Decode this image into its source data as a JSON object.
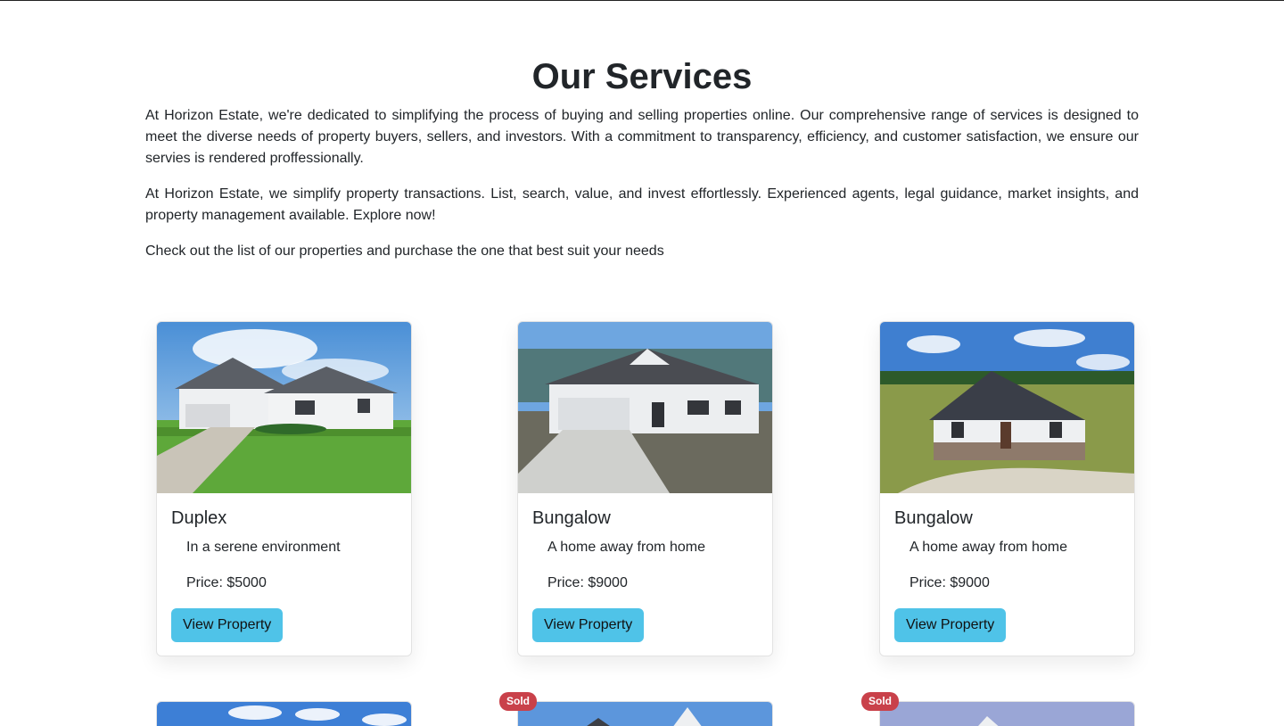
{
  "page": {
    "heading": "Our Services",
    "paragraphs": [
      "At Horizon Estate, we're dedicated to simplifying the process of buying and selling properties online. Our comprehensive range of services is designed to meet the diverse needs of property buyers, sellers, and investors. With a commitment to transparency, efficiency, and customer satisfaction, we ensure our servies is rendered proffessionally.",
      "At Horizon Estate, we simplify property transactions. List, search, value, and invest effortlessly. Experienced agents, legal guidance, market insights, and property management available. Explore now!",
      "Check out the list of our properties and purchase the one that best suit your needs"
    ]
  },
  "properties": [
    {
      "title": "Duplex",
      "description": "In a serene environment",
      "price": "Price: $5000",
      "button": "View Property"
    },
    {
      "title": "Bungalow",
      "description": "A home away from home",
      "price": "Price: $9000",
      "button": "View Property"
    },
    {
      "title": "Bungalow",
      "description": "A home away from home",
      "price": "Price: $9000",
      "button": "View Property"
    }
  ],
  "second_row": {
    "badges": [
      "Sold",
      "Sold"
    ]
  },
  "colors": {
    "button": "#4fc3e8",
    "sold_badge": "#c9414a",
    "text": "#212529"
  }
}
